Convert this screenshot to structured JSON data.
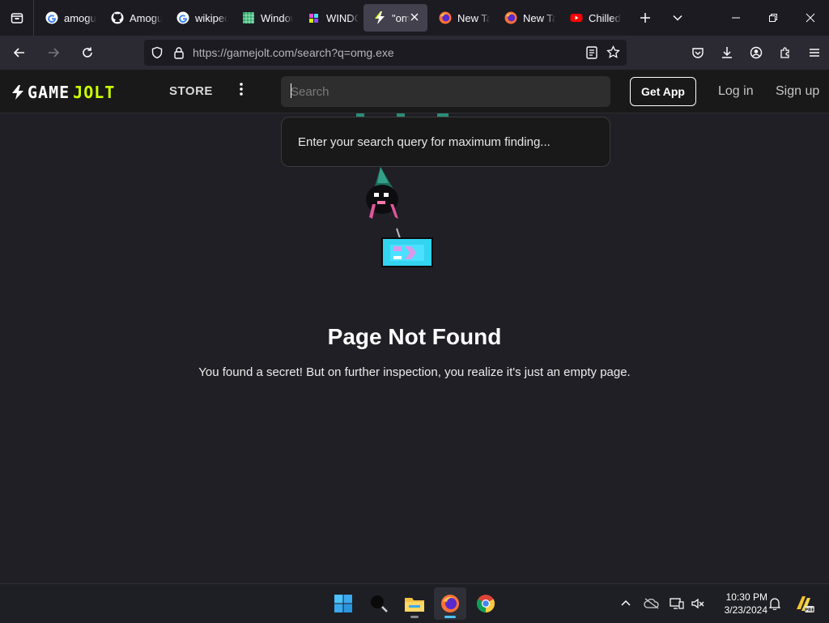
{
  "browser": {
    "tabs": [
      {
        "title": "amogus",
        "favicon": "google-g-icon",
        "active": false
      },
      {
        "title": "Amogus",
        "favicon": "github-icon",
        "active": false
      },
      {
        "title": "wikipedia",
        "favicon": "google-g-icon",
        "active": false
      },
      {
        "title": "Windows",
        "favicon": "green-grid-icon",
        "active": false
      },
      {
        "title": "WINDOWS",
        "favicon": "pixel-logo-icon",
        "active": false
      },
      {
        "title": "\"omg",
        "favicon": "gamejolt-bolt-icon",
        "active": true
      },
      {
        "title": "New Tab",
        "favicon": "firefox-icon",
        "active": false
      },
      {
        "title": "New Tab",
        "favicon": "firefox-icon",
        "active": false
      },
      {
        "title": "Chilled",
        "favicon": "youtube-icon",
        "active": false
      }
    ],
    "url_domain": "https://gamejolt.com",
    "url_path": "/search?q=omg.exe"
  },
  "site": {
    "logo_game": "GAME",
    "logo_jolt": "JOLT",
    "store_label": "STORE",
    "search_placeholder": "Search",
    "get_app_label": "Get App",
    "login_label": "Log in",
    "signup_label": "Sign up",
    "search_hint": "Enter your search query for maximum finding...",
    "not_found_title": "Page Not Found",
    "not_found_text": "You found a secret! But on further inspection, you realize it's just an empty page.",
    "accent_color": "#ccff00"
  },
  "taskbar": {
    "apps": [
      "windows-start-icon",
      "search-icon",
      "file-explorer-icon",
      "firefox-icon",
      "chrome-icon"
    ],
    "time": "10:30 PM",
    "date": "3/23/2024"
  }
}
